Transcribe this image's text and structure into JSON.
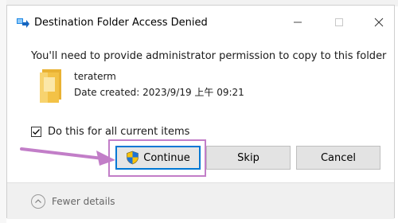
{
  "dialog": {
    "title": "Destination Folder Access Denied",
    "message": "You'll need to provide administrator permission to copy to this folder",
    "file": {
      "name": "teraterm",
      "date_created": "Date created: 2023/9/19 上午 09:21"
    },
    "checkbox": {
      "label": "Do this for all current items",
      "checked": true
    },
    "buttons": {
      "continue": "Continue",
      "skip": "Skip",
      "cancel": "Cancel"
    },
    "footer": {
      "toggle_label": "Fewer details"
    }
  },
  "colors": {
    "accent": "#0078d4",
    "annotation": "#c27ec8",
    "folder": "#f3c246"
  },
  "icons": {
    "app": "transfer-icon",
    "minimize": "minimize-icon",
    "maximize": "maximize-icon",
    "close": "close-icon",
    "folder": "folder-icon",
    "shield": "uac-shield-icon",
    "chevron": "chevron-up-icon"
  }
}
